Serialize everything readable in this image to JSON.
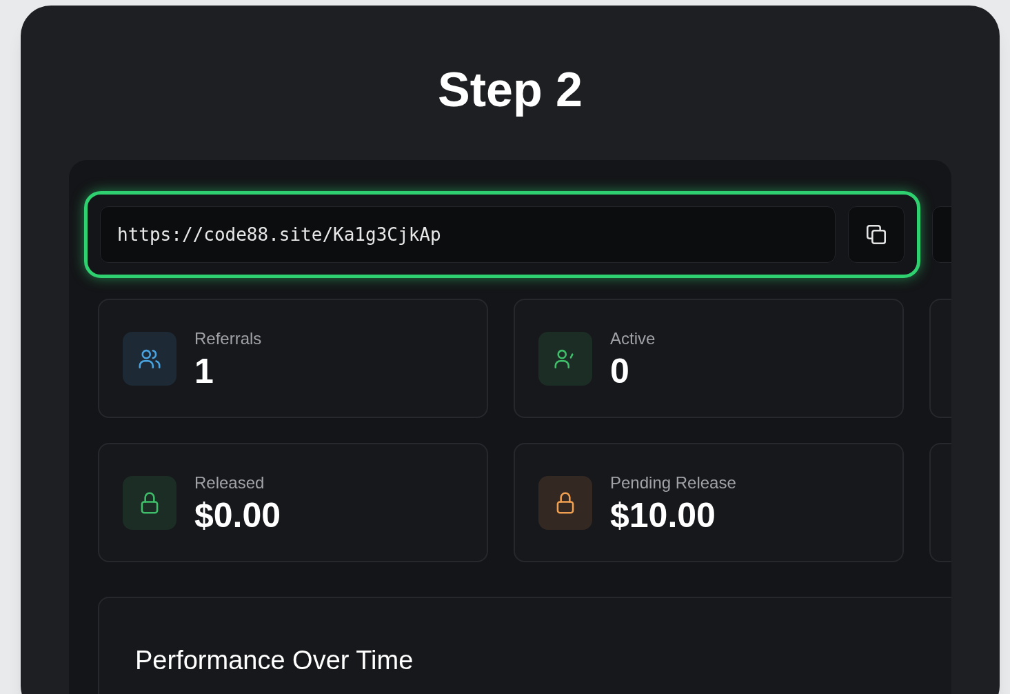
{
  "title": "Step 2",
  "referral_link": {
    "value": "https://code88.site/Ka1g3CjkAp"
  },
  "stats": [
    {
      "label": "Referrals",
      "value": "1",
      "kind": "users",
      "color": "#4aa3df"
    },
    {
      "label": "Active",
      "value": "0",
      "kind": "user-check",
      "color": "#3fbf6a"
    },
    {
      "label": "Released",
      "value": "$0.00",
      "kind": "lock",
      "color": "#3fbf6a"
    },
    {
      "label": "Pending Release",
      "value": "$10.00",
      "kind": "lock",
      "color": "#f0a050"
    }
  ],
  "performance": {
    "title": "Performance Over Time"
  }
}
